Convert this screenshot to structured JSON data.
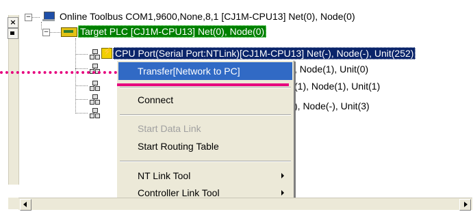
{
  "tree": {
    "root": {
      "label": "Online Toolbus COM1,9600,None,8,1 [CJ1M-CPU13] Net(0), Node(0)",
      "expander": "−"
    },
    "plc": {
      "label": "Target PLC [CJ1M-CPU13] Net(0), Node(0)",
      "expander": "−"
    },
    "cpu_port": {
      "label": "CPU Port(Serial Port:NTLink)[CJ1M-CPU13] Net(-), Node(-), Unit(252)"
    },
    "nodes": [
      {
        "label": ", Node(1), Unit(0)"
      },
      {
        "label": "(1), Node(1), Unit(1)"
      },
      {
        "label": "), Node(-), Unit(3)"
      }
    ]
  },
  "left_bar": {
    "close": "×"
  },
  "context_menu": {
    "items": [
      {
        "label": "Transfer[Network to PC]",
        "highlighted": true,
        "disabled": false,
        "submenu": false
      },
      {
        "label": "Connect",
        "highlighted": false,
        "disabled": false,
        "submenu": false
      },
      {
        "label": "Start Data Link",
        "highlighted": false,
        "disabled": true,
        "submenu": false
      },
      {
        "label": "Start Routing Table",
        "highlighted": false,
        "disabled": false,
        "submenu": false
      },
      {
        "label": "NT Link Tool",
        "highlighted": false,
        "disabled": false,
        "submenu": true
      },
      {
        "label": "Controller Link Tool",
        "highlighted": false,
        "disabled": false,
        "submenu": true
      }
    ]
  },
  "colors": {
    "selection_green": "#008000",
    "selection_blue": "#0a246a",
    "menu_highlight": "#316ac5",
    "annotation_pink": "#e6007e"
  }
}
